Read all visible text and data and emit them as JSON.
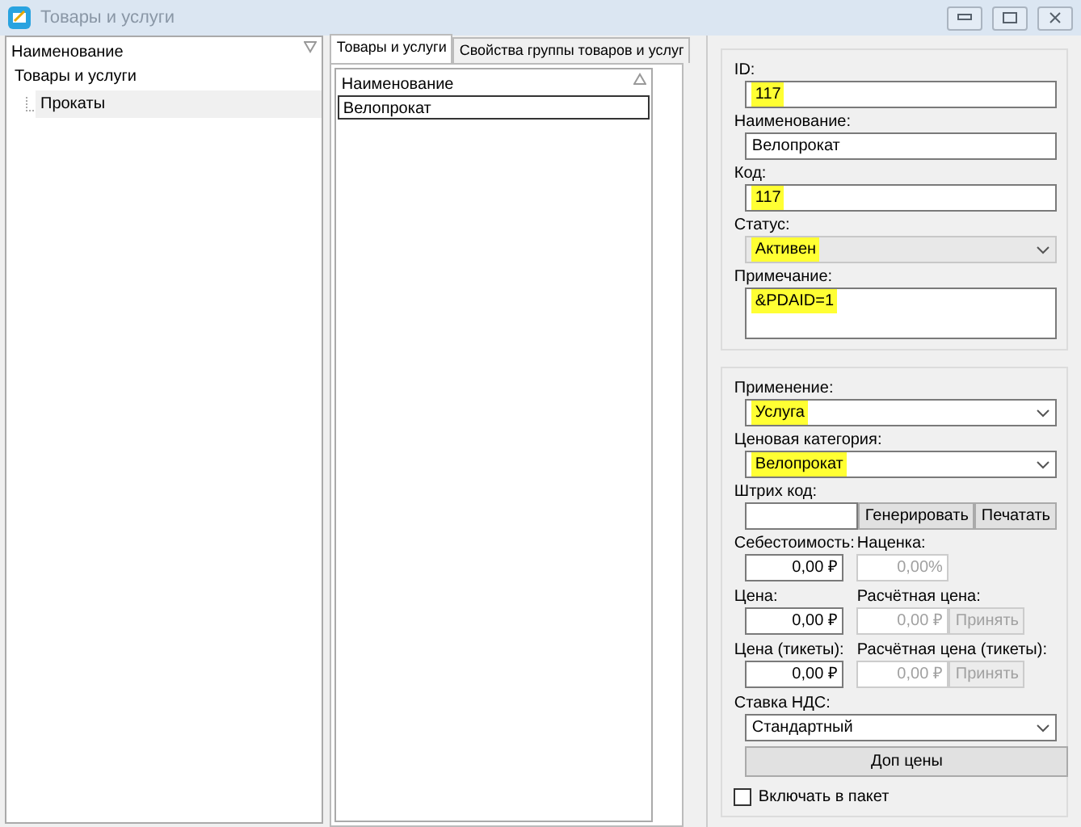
{
  "window": {
    "title": "Товары и услуги"
  },
  "tree": {
    "header": "Наименование",
    "items": [
      {
        "label": "Товары и услуги",
        "selected": false,
        "children": [
          {
            "label": "Прокаты",
            "selected": true
          }
        ]
      }
    ]
  },
  "tabs": [
    {
      "label": "Товары и услуги",
      "selected": true
    },
    {
      "label": "Свойства группы товаров и услуг",
      "selected": false
    }
  ],
  "list": {
    "header": "Наименование",
    "rows": [
      {
        "label": "Велопрокат",
        "selected": true
      }
    ]
  },
  "details": [
    {
      "kind": "text",
      "label": "ID:",
      "value": "117",
      "highlighted": true
    },
    {
      "kind": "text",
      "label": "Наименование:",
      "value": "Велопрокат",
      "highlighted": false
    },
    {
      "kind": "text",
      "label": "Код:",
      "value": "117",
      "highlighted": true
    },
    {
      "kind": "select",
      "label": "Статус:",
      "value": "Активен",
      "highlighted": true,
      "disabled": true
    },
    {
      "kind": "textarea",
      "label": "Примечание:",
      "value": "&PDAID=1",
      "highlighted": true
    }
  ],
  "pricing": [
    {
      "kind": "select",
      "label": "Применение:",
      "value": "Услуга",
      "highlighted": true,
      "disabled": false
    },
    {
      "kind": "select",
      "label": "Ценовая категория:",
      "value": "Велопрокат",
      "highlighted": true,
      "disabled": false
    },
    {
      "kind": "barcode",
      "label": "Штрих код:",
      "buttons": [
        "Генерировать",
        "Печатать"
      ]
    },
    {
      "kind": "pair",
      "fields": [
        {
          "label": "Себестоимость:",
          "value": "0,00 ₽",
          "disabled": false
        },
        {
          "label": "Наценка:",
          "value": "0,00%",
          "disabled": true
        }
      ]
    },
    {
      "kind": "pair",
      "fields": [
        {
          "label": "Цена:",
          "value": "0,00 ₽",
          "disabled": false
        },
        {
          "label": "Расчётная цена:",
          "value": "0,00 ₽",
          "disabled": true,
          "button": "Принять",
          "button_disabled": true
        }
      ]
    },
    {
      "kind": "pair",
      "fields": [
        {
          "label": "Цена (тикеты):",
          "value": "0,00 ₽",
          "disabled": false
        },
        {
          "label": "Расчётная цена (тикеты):",
          "value": "0,00 ₽",
          "disabled": true,
          "button": "Принять",
          "button_disabled": true
        }
      ]
    },
    {
      "kind": "select",
      "label": "Ставка НДС:",
      "value": "Стандартный",
      "highlighted": false,
      "disabled": false
    },
    {
      "kind": "button",
      "label": "Доп цены"
    },
    {
      "kind": "checkbox",
      "label": "Включать в пакет",
      "checked": false
    }
  ]
}
